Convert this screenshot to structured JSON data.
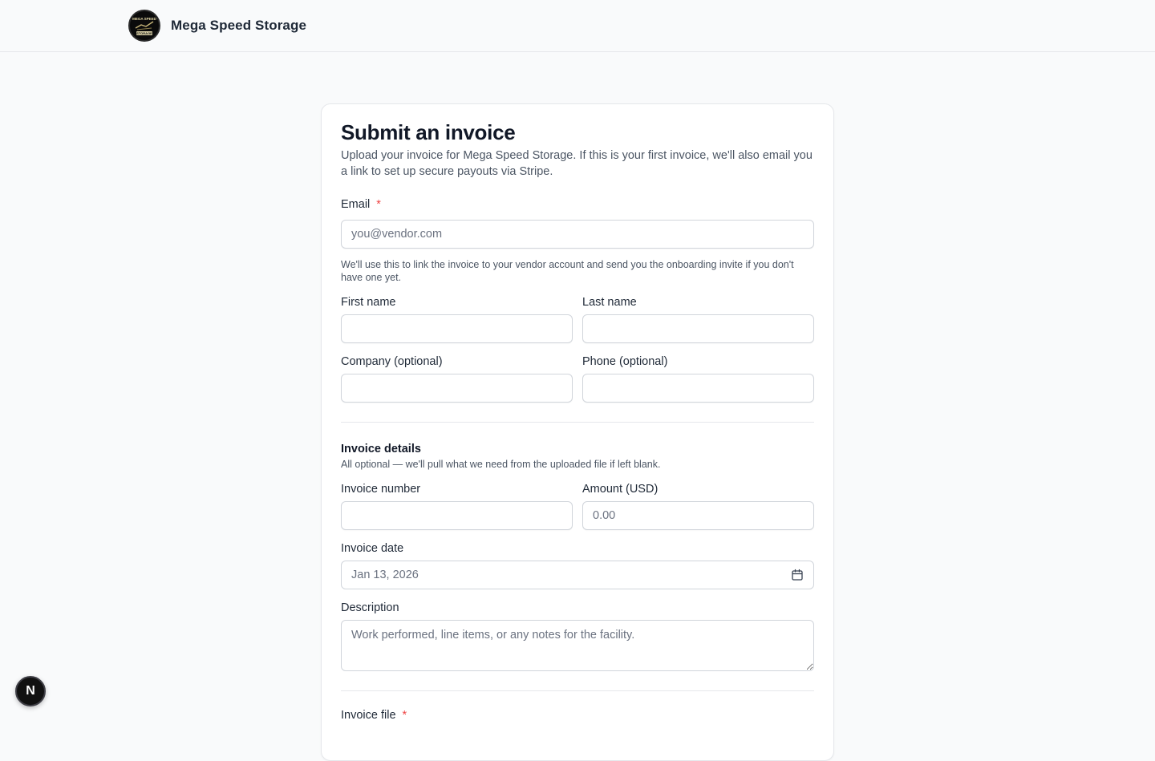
{
  "header": {
    "brand_name": "Mega Speed Storage",
    "logo_text_top": "MEGA SPEED",
    "logo_text_bottom": "STORAGE"
  },
  "form": {
    "title": "Submit an invoice",
    "subtitle": "Upload your invoice for Mega Speed Storage. If this is your first invoice, we'll also email you a link to set up secure payouts via Stripe.",
    "email": {
      "label": "Email",
      "required_mark": "*",
      "placeholder": "you@vendor.com",
      "value": "",
      "hint": "We'll use this to link the invoice to your vendor account and send you the onboarding invite if you don't have one yet."
    },
    "first_name": {
      "label": "First name",
      "value": ""
    },
    "last_name": {
      "label": "Last name",
      "value": ""
    },
    "company": {
      "label": "Company (optional)",
      "value": ""
    },
    "phone": {
      "label": "Phone (optional)",
      "value": ""
    },
    "invoice_details": {
      "title": "Invoice details",
      "subtitle": "All optional — we'll pull what we need from the uploaded file if left blank.",
      "invoice_number": {
        "label": "Invoice number",
        "value": ""
      },
      "amount": {
        "label": "Amount (USD)",
        "placeholder": "0.00",
        "value": ""
      },
      "invoice_date": {
        "label": "Invoice date",
        "value": "Jan 13, 2026",
        "icon": "calendar-icon"
      },
      "description": {
        "label": "Description",
        "placeholder": "Work performed, line items, or any notes for the facility.",
        "value": ""
      }
    },
    "invoice_file": {
      "label": "Invoice file",
      "required_mark": "*"
    }
  },
  "dev_badge": {
    "letter": "N"
  },
  "colors": {
    "background": "#f9fafb",
    "card": "#ffffff",
    "border": "#e5e7eb",
    "required": "#ef4444",
    "text_primary": "#111827",
    "text_muted": "#4b5563"
  }
}
